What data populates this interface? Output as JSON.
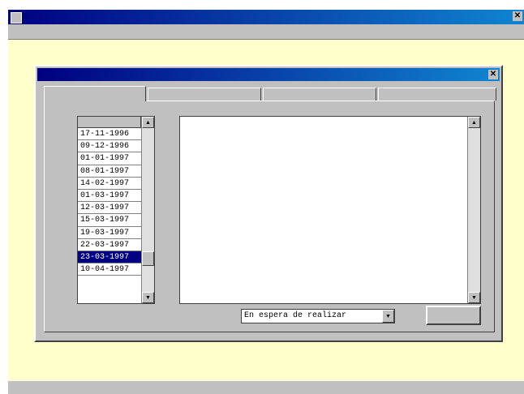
{
  "caption": "",
  "app": {
    "title": "",
    "menu": [
      "",
      "",
      ""
    ]
  },
  "dialog": {
    "title": "",
    "tabs": [
      "",
      "",
      "",
      ""
    ],
    "date_list": {
      "header": "",
      "dates": [
        "17-11-1996",
        "09-12-1996",
        "01-01-1997",
        "08-01-1997",
        "14-02-1997",
        "01-03-1997",
        "12-03-1997",
        "15-03-1997",
        "19-03-1997",
        "22-03-1997",
        "23-03-1997",
        "10-04-1997"
      ],
      "selected_index": 10
    },
    "text_content": "",
    "state_label": "",
    "state_value": "En espera de realizar",
    "print_button": ""
  },
  "colors": {
    "title_bar": "#000080",
    "workspace": "#ffffcc",
    "face": "#c0c0c0"
  }
}
